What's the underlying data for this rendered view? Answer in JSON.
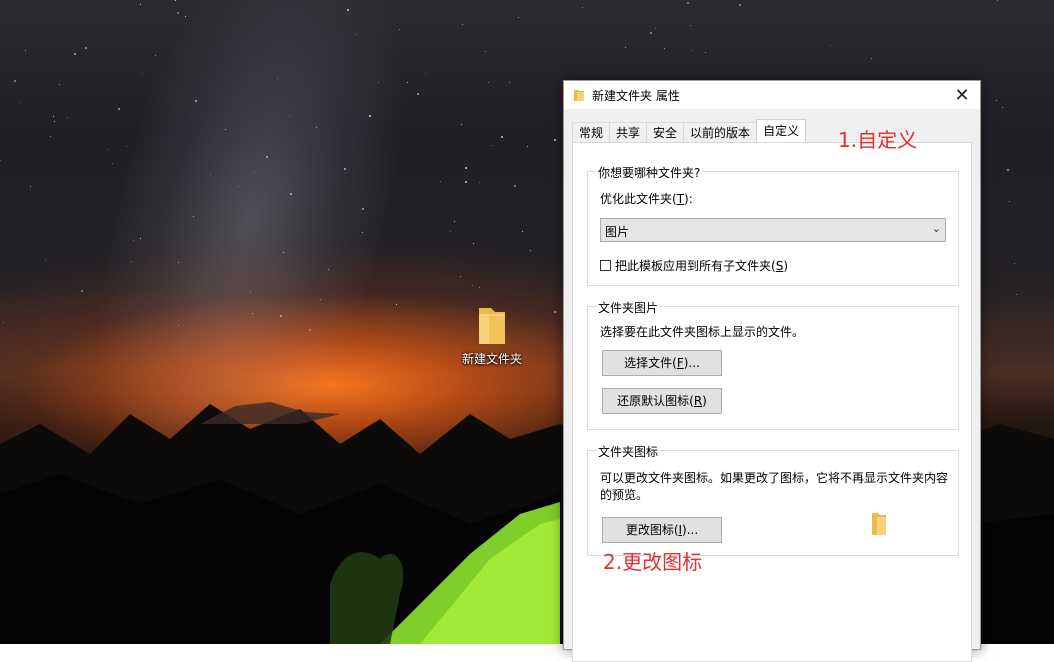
{
  "desktop": {
    "folder_label": "新建文件夹"
  },
  "dialog": {
    "title": "新建文件夹 属性",
    "close_glyph": "✕",
    "tabs": [
      {
        "label": "常规"
      },
      {
        "label": "共享"
      },
      {
        "label": "安全"
      },
      {
        "label": "以前的版本"
      },
      {
        "label": "自定义",
        "active": true
      }
    ],
    "folder_type": {
      "legend": "你想要哪种文件夹?",
      "optimize_label": "优化此文件夹(T):",
      "optimize_label_prefix": "优化此文件夹(",
      "optimize_label_key": "T",
      "optimize_label_suffix": "):",
      "select_value": "图片",
      "apply_prefix": "把此模板应用到所有子文件夹(",
      "apply_key": "S",
      "apply_suffix": ")",
      "apply_checked": false
    },
    "folder_picture": {
      "legend": "文件夹图片",
      "description": "选择要在此文件夹图标上显示的文件。",
      "choose_prefix": "选择文件(",
      "choose_key": "F",
      "choose_suffix": ")...",
      "restore_prefix": "还原默认图标(",
      "restore_key": "R",
      "restore_suffix": ")"
    },
    "folder_icon": {
      "legend": "文件夹图标",
      "description_line1": "可以更改文件夹图标。如果更改了图标，它将不再显示文件夹内容",
      "description_line2": "的预览。",
      "change_prefix": "更改图标(",
      "change_key": "I",
      "change_suffix": ")..."
    }
  },
  "annotations": {
    "step1": "1.自定义",
    "step2": "2.更改图标",
    "color": "#e52f2f"
  }
}
